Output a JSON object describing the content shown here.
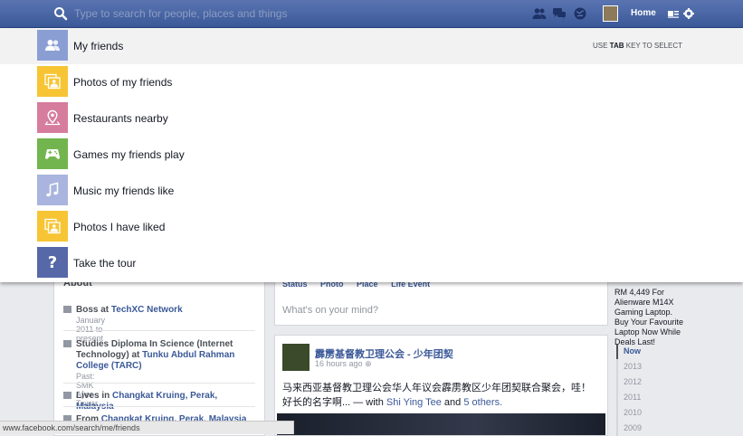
{
  "topbar": {
    "search_placeholder": "Type to search for people, places and things",
    "home_label": "Home",
    "icons": [
      "search-icon",
      "friend-requests-icon",
      "messages-icon",
      "notifications-icon",
      "privacy-icon",
      "settings-icon"
    ]
  },
  "dropdown": {
    "hint_prefix": "USE ",
    "hint_key": "TAB",
    "hint_suffix": " KEY TO SELECT",
    "items": [
      {
        "label": "My friends",
        "icon": "friends-icon",
        "color": "#8b9ed4"
      },
      {
        "label": "Photos of my friends",
        "icon": "photos-icon",
        "color": "#f7c534"
      },
      {
        "label": "Restaurants nearby",
        "icon": "map-pin-icon",
        "color": "#d67c9d"
      },
      {
        "label": "Games my friends play",
        "icon": "game-controller-icon",
        "color": "#72b54e"
      },
      {
        "label": "Music my friends like",
        "icon": "music-note-icon",
        "color": "#a9b5de"
      },
      {
        "label": "Photos I have liked",
        "icon": "photos-icon",
        "color": "#f7c534"
      },
      {
        "label": "Take the tour",
        "icon": "question-icon",
        "color": "#5668a8"
      }
    ]
  },
  "about": {
    "title": "About",
    "rows": [
      {
        "prefix": "Boss at ",
        "link": "TechXC Network",
        "sub": "January 2011 to present"
      },
      {
        "prefix": "Studies Diploma In Science (Internet Technology) at ",
        "link": "Tunku Abdul Rahman College (TARC)",
        "sub": "Past: SMK Ayer Tawar"
      },
      {
        "prefix": "Lives in ",
        "link": "Changkat Kruing, Perak, Malaysia",
        "sub": ""
      },
      {
        "prefix": "From ",
        "link": "Changkat Kruing, Perak, Malaysia",
        "sub": ""
      }
    ]
  },
  "composer": {
    "tabs": [
      "Status",
      "Photo",
      "Place",
      "Life Event"
    ],
    "placeholder": "What's on your mind?"
  },
  "post": {
    "author": "霹雳基督教卫理公会 - 少年团契",
    "time": "16 hours ago",
    "text": "马来西亚基督教卫理公会华人年议会霹雳教区少年团契联合聚会，哇！好长的名字啊...",
    "with_prefix": " — with ",
    "with_name": "Shi Ying Tee",
    "with_and": " and ",
    "with_others": "5 others."
  },
  "ad": {
    "price": "RM 4,449 For Alienware M14X Gaming Laptop.",
    "text": "Buy Your Favourite Laptop Now While Deals Last!"
  },
  "timeline": [
    "Now",
    "2013",
    "2012",
    "2011",
    "2010",
    "2009"
  ],
  "statusbar": {
    "url": "www.facebook.com/search/me/friends"
  }
}
